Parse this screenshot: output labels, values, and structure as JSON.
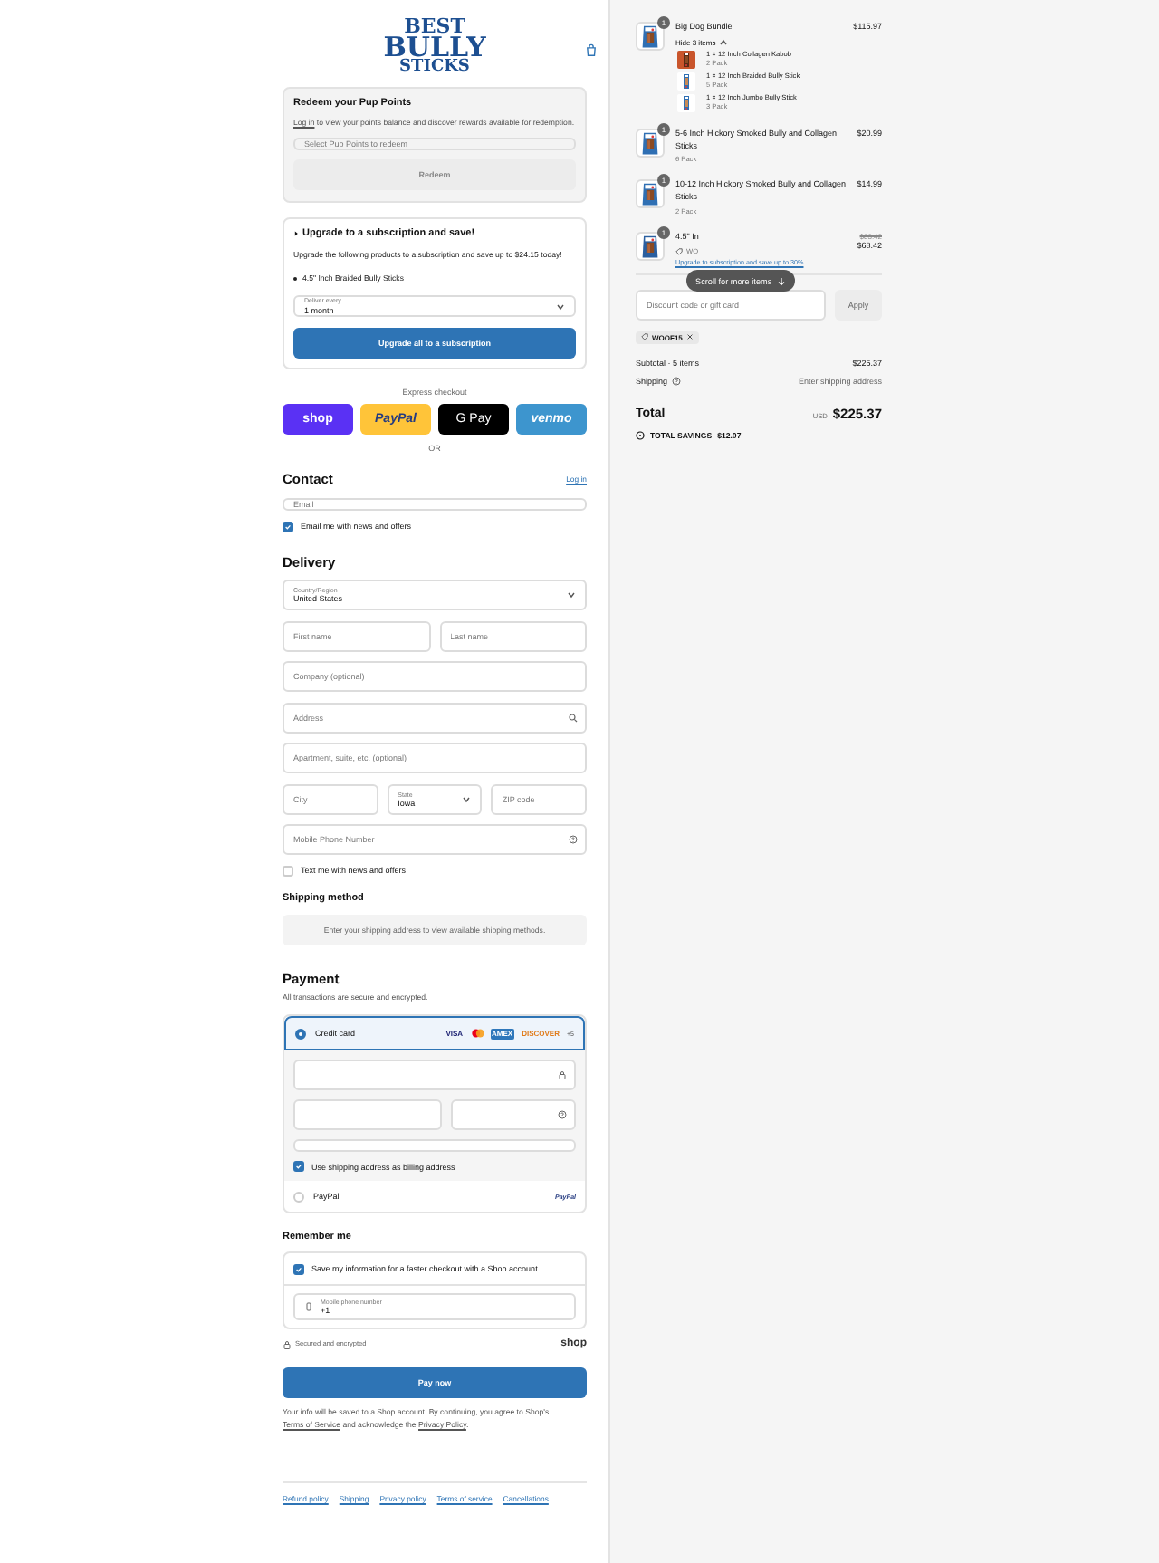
{
  "header": {
    "logo": [
      "BEST",
      "BULLY",
      "STICKS"
    ]
  },
  "pup_points": {
    "title": "Redeem your Pup Points",
    "login_link": "Log in",
    "text": " to view your points balance and discover rewards available for redemption.",
    "select_placeholder": "Select Pup Points to redeem",
    "button": "Redeem"
  },
  "subscription": {
    "title": "Upgrade to a subscription and save!",
    "text": "Upgrade the following products to a subscription and save up to $24.15 today!",
    "products": [
      "4.5\" Inch Braided Bully Sticks"
    ],
    "frequency": {
      "label": "Deliver every",
      "value": "1 month"
    },
    "button": "Upgrade all to a subscription"
  },
  "express": {
    "label": "Express checkout",
    "buttons": [
      {
        "kind": "shop",
        "label": "shop"
      },
      {
        "kind": "paypal",
        "label": "PayPal"
      },
      {
        "kind": "gpay",
        "label": "G Pay"
      },
      {
        "kind": "venmo",
        "label": "venmo"
      }
    ],
    "or": "OR"
  },
  "contact": {
    "title": "Contact",
    "login": "Log in",
    "email_placeholder": "Email",
    "news": {
      "label": "Email me with news and offers",
      "checked": true
    }
  },
  "delivery": {
    "title": "Delivery",
    "rows": [
      [
        {
          "kind": "select",
          "label": "Country/Region",
          "value": "United States"
        }
      ],
      [
        {
          "kind": "text",
          "placeholder": "First name"
        },
        {
          "kind": "text",
          "placeholder": "Last name"
        }
      ],
      [
        {
          "kind": "text",
          "placeholder": "Company (optional)"
        }
      ],
      [
        {
          "kind": "search",
          "placeholder": "Address"
        }
      ],
      [
        {
          "kind": "text",
          "placeholder": "Apartment, suite, etc. (optional)"
        }
      ],
      [
        {
          "kind": "text",
          "placeholder": "City"
        },
        {
          "kind": "select",
          "label": "State",
          "value": "Iowa"
        },
        {
          "kind": "text",
          "placeholder": "ZIP code"
        }
      ],
      [
        {
          "kind": "help",
          "placeholder": "Mobile Phone Number"
        }
      ]
    ],
    "sms": {
      "label": "Text me with news and offers",
      "checked": false
    }
  },
  "shipping_method": {
    "title": "Shipping method",
    "message": "Enter your shipping address to view available shipping methods."
  },
  "payment": {
    "title": "Payment",
    "subtitle": "All transactions are secure and encrypted.",
    "methods": [
      {
        "kind": "card",
        "label": "Credit card",
        "selected": true,
        "brands": [
          {
            "kind": "visa",
            "label": "VISA"
          },
          {
            "kind": "mastercard"
          },
          {
            "kind": "amex",
            "label": "AMEX"
          },
          {
            "kind": "discover",
            "label": "DISCOVER"
          }
        ],
        "more": "+5"
      },
      {
        "kind": "paypal",
        "label": "PayPal",
        "selected": false,
        "logo": "PayPal"
      }
    ],
    "billing": {
      "label": "Use shipping address as billing address",
      "checked": true
    }
  },
  "remember": {
    "title": "Remember me",
    "save": {
      "label": "Save my information for a faster checkout with a Shop account",
      "checked": true
    },
    "phone": {
      "label": "Mobile phone number",
      "value": "+1"
    },
    "secure": "Secured and encrypted",
    "brand": "shop"
  },
  "pay_button": "Pay now",
  "legal": {
    "before": "Your info will be saved to a Shop account. By continuing, you agree to Shop's ",
    "terms": "Terms of Service",
    "middle": " and acknowledge the ",
    "privacy": "Privacy Policy",
    "after": "."
  },
  "footer_links": [
    "Refund policy",
    "Shipping",
    "Privacy policy",
    "Terms of service",
    "Cancellations"
  ],
  "summary": {
    "items": [
      {
        "name": "Big Dog Bundle",
        "quantity": "1",
        "price": "$115.97",
        "toggle": "Hide 3 items",
        "expanded": true,
        "children": [
          {
            "name": "1 × 12 Inch Collagen Kabob",
            "variant": "2 Pack"
          },
          {
            "name": "1 × 12 Inch Braided Bully Stick",
            "variant": "5 Pack"
          },
          {
            "name": "1 × 12 Inch Jumbo Bully Stick",
            "variant": "3 Pack"
          }
        ]
      },
      {
        "name": "5-6 Inch Hickory Smoked Bully and Collagen Sticks",
        "variant": "6 Pack",
        "quantity": "1",
        "price": "$20.99"
      },
      {
        "name": "10-12 Inch Hickory Smoked Bully and Collagen Sticks",
        "variant": "2 Pack",
        "quantity": "1",
        "price": "$14.99"
      },
      {
        "name": "4.5\" In",
        "tag": "WO",
        "quantity": "1",
        "compare_price": "$83.42",
        "price": "$68.42",
        "upgrade_link": "Upgrade to subscription and save up to 30%"
      }
    ],
    "scroll_hint": "Scroll for more items",
    "discount": {
      "placeholder": "Discount code or gift card",
      "button": "Apply",
      "codes": [
        "WOOF15"
      ]
    },
    "subtotal": {
      "label": "Subtotal · 5 items",
      "value": "$225.37"
    },
    "shipping": {
      "label": "Shipping",
      "value": "Enter shipping address"
    },
    "total": {
      "label": "Total",
      "currency": "USD",
      "value": "$225.37"
    },
    "savings": {
      "label": "TOTAL SAVINGS",
      "value": "$12.07"
    }
  }
}
